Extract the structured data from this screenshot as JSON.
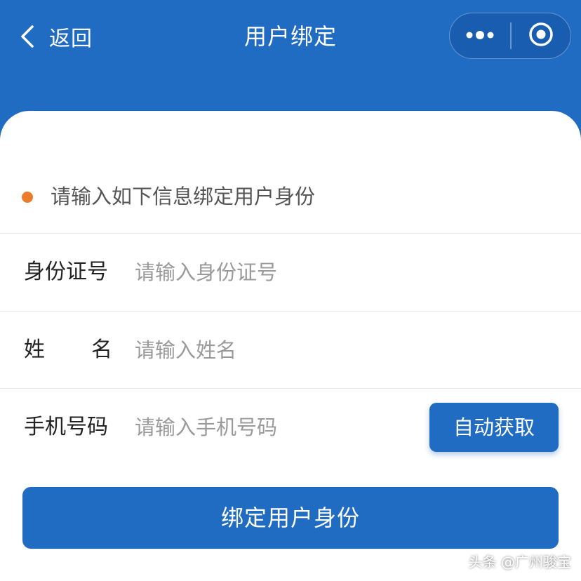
{
  "header": {
    "back_label": "返回",
    "title": "用户绑定",
    "more_icon": "more-dots-icon",
    "close_icon": "circle-target-icon",
    "bg_color": "#1f6cc2"
  },
  "form": {
    "hint": "请输入如下信息绑定用户身份",
    "hint_dot_color": "#ea7b2b",
    "fields": [
      {
        "label": "身份证号",
        "value": "",
        "placeholder": "请输入身份证号"
      },
      {
        "label_chars": [
          "姓",
          "名"
        ],
        "value": "",
        "placeholder": "请输入姓名"
      },
      {
        "label": "手机号码",
        "value": "",
        "placeholder": "请输入手机号码",
        "action_label": "自动获取"
      }
    ],
    "submit_label": "绑定用户身份"
  },
  "watermark": "头条 @广州骏宝"
}
